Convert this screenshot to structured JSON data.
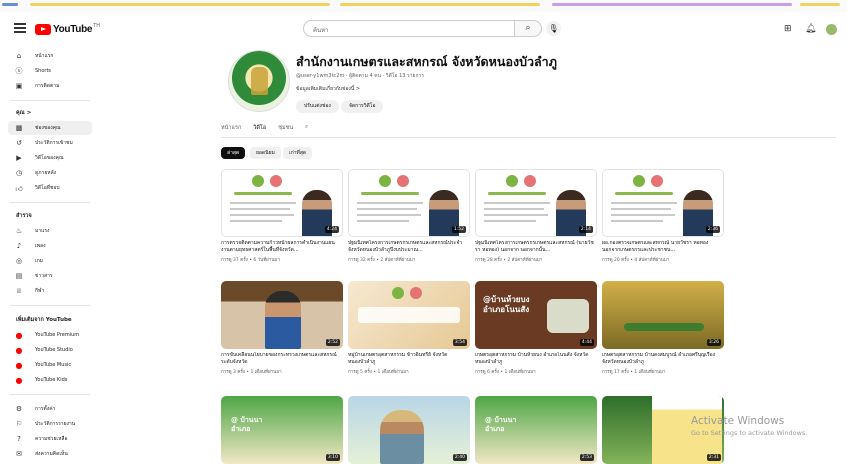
{
  "header": {
    "logo_text": "YouTube",
    "logo_sup": "TH",
    "search_placeholder": "ค้นหา",
    "icons": [
      "menu-icon",
      "search-icon",
      "mic-icon",
      "create-icon",
      "bell-icon",
      "avatar"
    ]
  },
  "sidebar": {
    "main": [
      {
        "label": "หน้าแรก",
        "icon": "home-icon"
      },
      {
        "label": "Shorts",
        "icon": "shorts-icon"
      },
      {
        "label": "การติดตาม",
        "icon": "subscriptions-icon"
      }
    ],
    "you_header": "คุณ  >",
    "you": [
      {
        "label": "ช่องของคุณ",
        "icon": "channel-icon"
      },
      {
        "label": "ประวัติการเข้าชม",
        "icon": "history-icon"
      },
      {
        "label": "วิดีโอของคุณ",
        "icon": "video-icon"
      },
      {
        "label": "ดูภายหลัง",
        "icon": "clock-icon"
      },
      {
        "label": "วิดีโอที่ชอบ",
        "icon": "like-icon"
      }
    ],
    "explore_header": "สำรวจ",
    "explore": [
      {
        "label": "มาแรง",
        "icon": "trending-icon"
      },
      {
        "label": "เพลง",
        "icon": "music-icon"
      },
      {
        "label": "เกม",
        "icon": "gaming-icon"
      },
      {
        "label": "ข่าวสาร",
        "icon": "news-icon"
      },
      {
        "label": "กีฬา",
        "icon": "sports-icon"
      }
    ],
    "more_header": "เพิ่มเติมจาก YouTube",
    "more": [
      {
        "label": "YouTube Premium",
        "icon": "youtube-premium-icon"
      },
      {
        "label": "YouTube Studio",
        "icon": "youtube-studio-icon"
      },
      {
        "label": "YouTube Music",
        "icon": "youtube-music-icon"
      },
      {
        "label": "YouTube Kids",
        "icon": "youtube-kids-icon"
      }
    ],
    "settings": [
      {
        "label": "การตั้งค่า",
        "icon": "gear-icon"
      },
      {
        "label": "ประวัติการรายงาน",
        "icon": "flag-icon"
      },
      {
        "label": "ความช่วยเหลือ",
        "icon": "help-icon"
      },
      {
        "label": "ส่งความคิดเห็น",
        "icon": "feedback-icon"
      }
    ]
  },
  "channel": {
    "title": "สำนักงานเกษตรและสหกรณ์ จังหวัดหนองบัวลำภู",
    "meta": "@user-y1wm3tc2m · ผู้ติดตาม 4 คน · วิดีโอ 13 รายการ",
    "desc": "ข้อมูลเพิ่มเติมเกี่ยวกับช่องนี้  >",
    "btn_customize": "ปรับแต่งช่อง",
    "btn_manage": "จัดการวิดีโอ",
    "tabs": [
      "หน้าแรก",
      "วิดีโอ",
      "ชุมชน"
    ],
    "active_tab": "วิดีโอ",
    "chips": [
      "ล่าสุด",
      "ยอดนิยม",
      "เก่าที่สุด"
    ],
    "active_chip": "ล่าสุด"
  },
  "videos": [
    {
      "title": "การตรวจติดตามความก้าวหน้าผลการดำเนินงานแผนงานตามยุทธศาสตร์ในพื้นที่จังหวัด...",
      "meta": "การดู 37 ครั้ง • 6 วันที่ผ่านมา",
      "duration": "4:24"
    },
    {
      "title": "ปฐมนิเทศโครงการเกษตรกรเกษตรและสหกรณ์ประจำจังหวัดหนองบัวลำภูปีงบประมาณ...",
      "meta": "การดู 32 ครั้ง • 2 สัปดาห์ที่ผ่านมา",
      "duration": "1:52"
    },
    {
      "title": "ปฐมนิเทศโครงการเกษตรกรเกษตรและสหกรณ์ (นายวัชรา หอทอง) นอกจาก นอกจากนั้น...",
      "meta": "การดู 28 ครั้ง • 2 สัปดาห์ที่ผ่านมา",
      "duration": "2:14"
    },
    {
      "title": "ผอ.กองตรวจเกษตรและสหกรณ์ นายวัชรา หอทอง นอกจากเกษตรกรและประชาชน...",
      "meta": "การดู 20 ครั้ง • 4 สัปดาห์ที่ผ่านมา",
      "duration": "2:36"
    },
    {
      "title": "การขับเคลื่อนนโยบายของกระทรวงเกษตรและสหกรณ์ระดับจังหวัด",
      "meta": "การดู 3 ครั้ง • 1 เดือนที่ผ่านมา",
      "duration": "2:52"
    },
    {
      "title": "หมู่บ้านเกษตรอุตสาหกรรม ข้าวอินทรีย์ จังหวัดหนองบัวลำภู",
      "meta": "การดู 5 ครั้ง • 1 เดือนที่ผ่านมา",
      "duration": "3:54"
    },
    {
      "title": "เกษตรอุตสาหกรรม บ้านห้วยบง อำเภอโนนสัง จังหวัดหนองบัวลำภู",
      "meta": "การดู 6 ครั้ง • 1 เดือนที่ผ่านมา",
      "duration": "4:44"
    },
    {
      "title": "เกษตรอุตสาหกรรม บ้านดงสมบูรณ์ อำเภอศรีบุญเรือง จังหวัดหนองบัวลำภู",
      "meta": "การดู 17 ครั้ง • 1 เดือนที่ผ่านมา",
      "duration": "3:26"
    },
    {
      "title": "",
      "meta": "",
      "duration": "3:10"
    },
    {
      "title": "",
      "meta": "",
      "duration": "2:40"
    },
    {
      "title": "",
      "meta": "",
      "duration": "2:53"
    },
    {
      "title": "",
      "meta": "",
      "duration": "2:31"
    }
  ],
  "watermark": {
    "line1": "Activate Windows",
    "line2": "Go to Settings to activate Windows."
  },
  "colors": {
    "brand": "#ff0000",
    "accent": "#0f0f0f"
  }
}
